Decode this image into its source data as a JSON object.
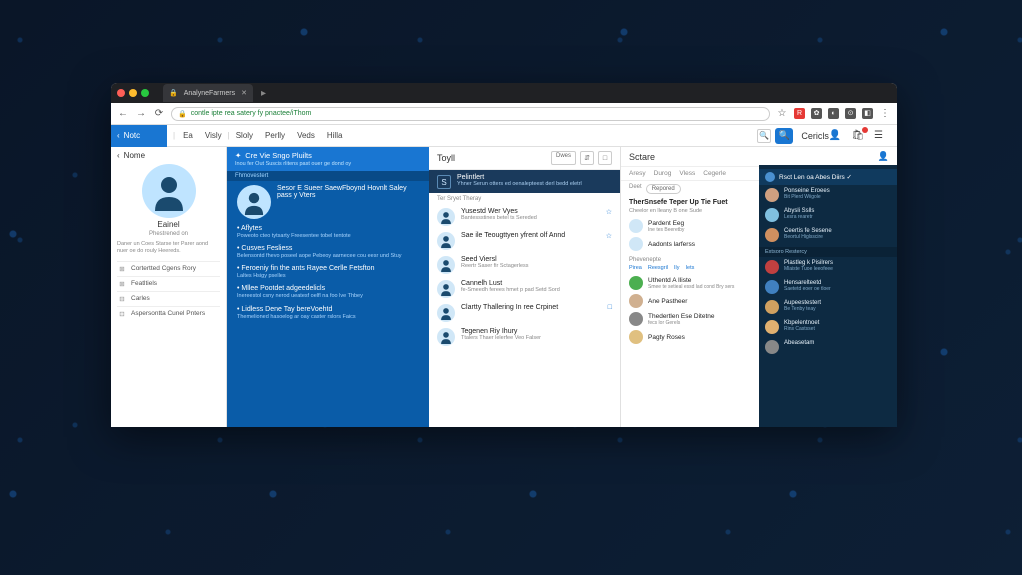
{
  "browser": {
    "tab_title": "AnalyneFarmers",
    "url": "contle ipte rea satery fy pnactee/iThom"
  },
  "toolbar": {
    "brand": "Notc",
    "menu": [
      "Ea",
      "Visly",
      "Sloly",
      "Perlly",
      "Veds",
      "Hilla"
    ],
    "right_title": "Cericls"
  },
  "sidebar": {
    "header": "Nome",
    "name": "Eainel",
    "sub": "Phestrened on",
    "desc": "Daner un Coes Starse ter Parer aond nuer oe do rouly Heereds.",
    "items": [
      {
        "icon": "⊞",
        "label": "Cortertted Cgens Rory"
      },
      {
        "icon": "⊞",
        "label": "Featltiels"
      },
      {
        "icon": "⊟",
        "label": "Carles"
      },
      {
        "icon": "⊡",
        "label": "Aspersontta Cunel Pnters"
      }
    ]
  },
  "bluepanel": {
    "title": "Cre Vie Sngo Pluilts",
    "subtitle": "Inou fer Out Suscis rlitens past ouer ge dond oy",
    "category": "Fhmovestert",
    "lead_title": "Sesor E Sueer SaewFboynd Hovnlt Saley pass y Vters",
    "items": [
      {
        "t": "Aflytes",
        "d": "Poweoto cteo tytsarty Freesentee tobel tentote"
      },
      {
        "t": "Cusves Fesliess",
        "d": "Belensontd fhevo poseel aope Pebeoy aarnecee cou eesr und Stuy"
      },
      {
        "t": "Feroeniy fin the ants Rayee Cerlle Fetsfton",
        "d": "Laltes Hsigy pselles"
      },
      {
        "t": "Mllee Pootdet adgeedelicls",
        "d": "Inereestol csny nerod ueatesf oelfl na foo lve Thbey"
      },
      {
        "t": "Lidless Dene Tay bereVoehtd",
        "d": "Themelioned hasoelog ar oay caster rslors Faics"
      }
    ]
  },
  "feed": {
    "title": "Toyll",
    "actions": [
      "Dwes",
      "⇵",
      "□"
    ],
    "banner": {
      "title": "Pelintlert",
      "sub": "Yhner Serun otters ed oenalepteest derl bedd eletrl"
    },
    "label": "Ter Sryet Theray",
    "items": [
      {
        "name": "Yusestd Wer Vyes",
        "sub": "Bantessstines betel ts Sereded",
        "star": "☆"
      },
      {
        "name": "Sae ile Teougttyen yfrent olf Annd",
        "sub": "",
        "star": "☆"
      },
      {
        "name": "Seed Viersl",
        "sub": "Reertr Saser fir Sctagerless",
        "star": ""
      },
      {
        "name": "Cannelh Lust",
        "sub": "fe-Smeedh ferees hmet p pad Setd Sord",
        "star": ""
      },
      {
        "name": "Clartty Thallering In ree Crpinet",
        "sub": "",
        "star": "□"
      },
      {
        "name": "Tegenen Riy Ihury",
        "sub": "Ttalers Thaer lelerfee Veo Falser",
        "star": ""
      }
    ]
  },
  "rightcol": {
    "title": "Sctare",
    "tabs": [
      "Aresy",
      "Durog",
      "Vless",
      "Cegerle"
    ],
    "filter_label": "Deet",
    "filter_value": "Repored",
    "section_title": "TherSnsefe Teper Up Tie Fuet",
    "section_sub": "Cheelor en lleany B one Sude",
    "items": [
      {
        "name": "Pardent Eeg",
        "sub": "Ine tes Beeretby",
        "color": "#d0e7f7"
      },
      {
        "name": "Aadonts larferss",
        "sub": "",
        "color": "#d0e7f7"
      }
    ],
    "subhead": "Phevenepte",
    "links": [
      "Pirea",
      "Reesgril",
      "Ily",
      "Iets"
    ],
    "items2": [
      {
        "name": "Uthentd A Iliste",
        "sub": "Smee te setieal essd lad cond Bry sers",
        "color": "#4caf50"
      },
      {
        "name": "Ane Pastheer",
        "sub": "",
        "color": "#d0b090"
      },
      {
        "name": "Thedertlen Ese Ditetne",
        "sub": "fecs lor Gerels",
        "color": "#888"
      },
      {
        "name": "Pagty Roses",
        "sub": "",
        "color": "#e0c080"
      }
    ]
  },
  "darkpanel": {
    "header": "Rsct Len oa Abes Diirs ✓",
    "items1": [
      {
        "name": "Ponseine Eroees",
        "sub": "Bit Plerd Wiigole",
        "color": "#d0a080"
      },
      {
        "name": "Abysli Sslls",
        "sub": "Lesra rearetr",
        "color": "#80c0e0"
      },
      {
        "name": "Ceertis fe Sesene",
        "sub": "Beortul Higlsscire",
        "color": "#d09060"
      }
    ],
    "section": "Extsoro Restercy",
    "items2": [
      {
        "name": "Plastleg k Pisilrers",
        "sub": "Mlaiste Tuoe leeofeee",
        "color": "#c04040"
      },
      {
        "name": "Hensarelteetd",
        "sub": "Saetetd eoer oe tloer",
        "color": "#4080c0"
      },
      {
        "name": "Aupeestestert",
        "sub": "Be Tenby teay",
        "color": "#d0a060"
      },
      {
        "name": "Kbpelentnoet",
        "sub": "Rins Castsset",
        "color": "#e0b070"
      },
      {
        "name": "Abeasetam",
        "sub": "",
        "color": "#888"
      }
    ]
  }
}
